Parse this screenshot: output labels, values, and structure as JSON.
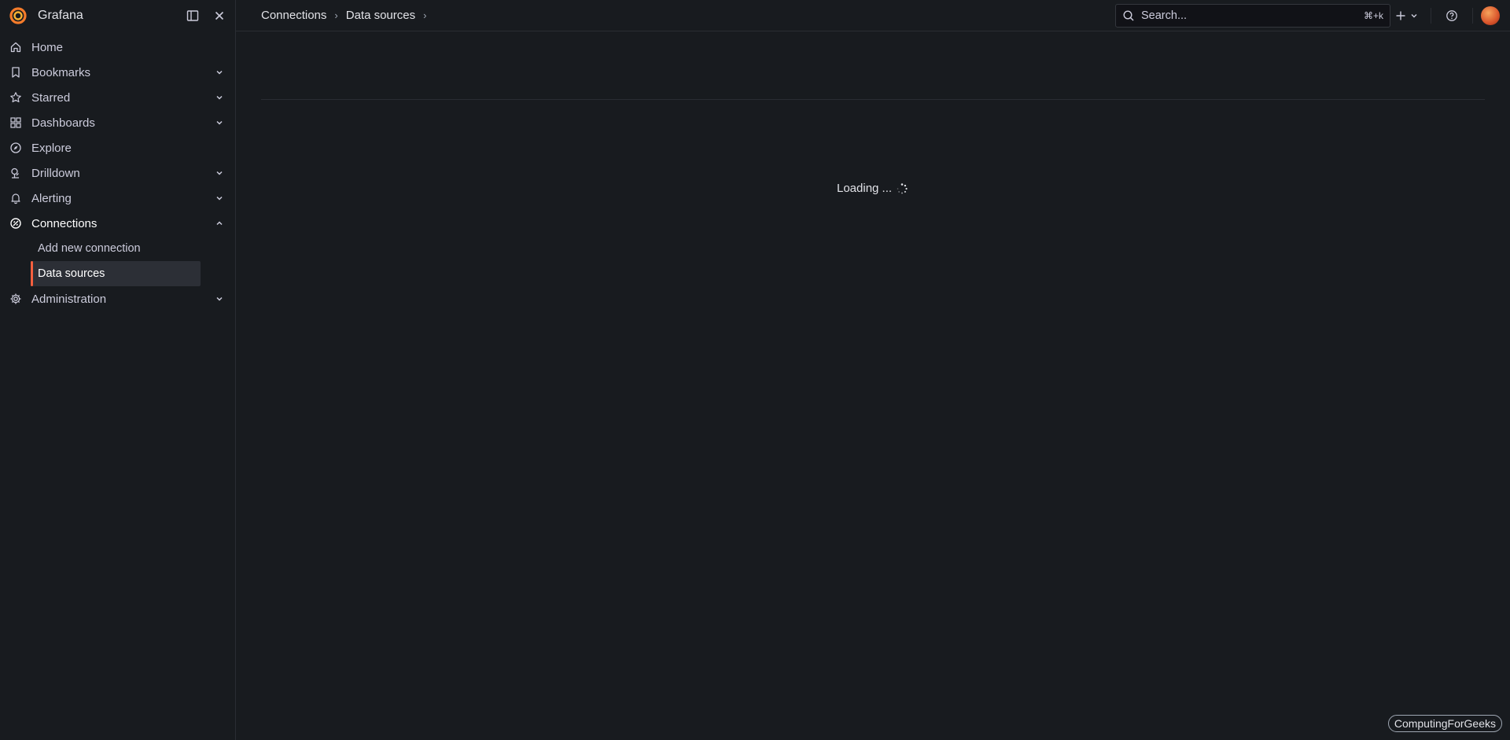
{
  "app": {
    "name": "Grafana",
    "accent": "#f55f3e"
  },
  "sidebar": {
    "items": [
      {
        "label": "Home",
        "icon": "home-icon",
        "chevron": ""
      },
      {
        "label": "Bookmarks",
        "icon": "bookmark-icon",
        "chevron": "down"
      },
      {
        "label": "Starred",
        "icon": "star-icon",
        "chevron": "down"
      },
      {
        "label": "Dashboards",
        "icon": "apps-icon",
        "chevron": "down"
      },
      {
        "label": "Explore",
        "icon": "compass-icon",
        "chevron": ""
      },
      {
        "label": "Drilldown",
        "icon": "drilldown-icon",
        "chevron": "down"
      },
      {
        "label": "Alerting",
        "icon": "bell-icon",
        "chevron": "down"
      },
      {
        "label": "Connections",
        "icon": "connections-icon",
        "chevron": "up"
      },
      {
        "label": "Administration",
        "icon": "cog-icon",
        "chevron": "down"
      }
    ],
    "connections_children": [
      {
        "label": "Add new connection",
        "active": false
      },
      {
        "label": "Data sources",
        "active": true
      }
    ]
  },
  "topbar": {
    "breadcrumb": [
      "Connections",
      "Data sources"
    ],
    "search": {
      "placeholder": "Search...",
      "shortcut": "⌘+k"
    }
  },
  "main": {
    "loading_text": "Loading ..."
  },
  "watermark": "ComputingForGeeks"
}
